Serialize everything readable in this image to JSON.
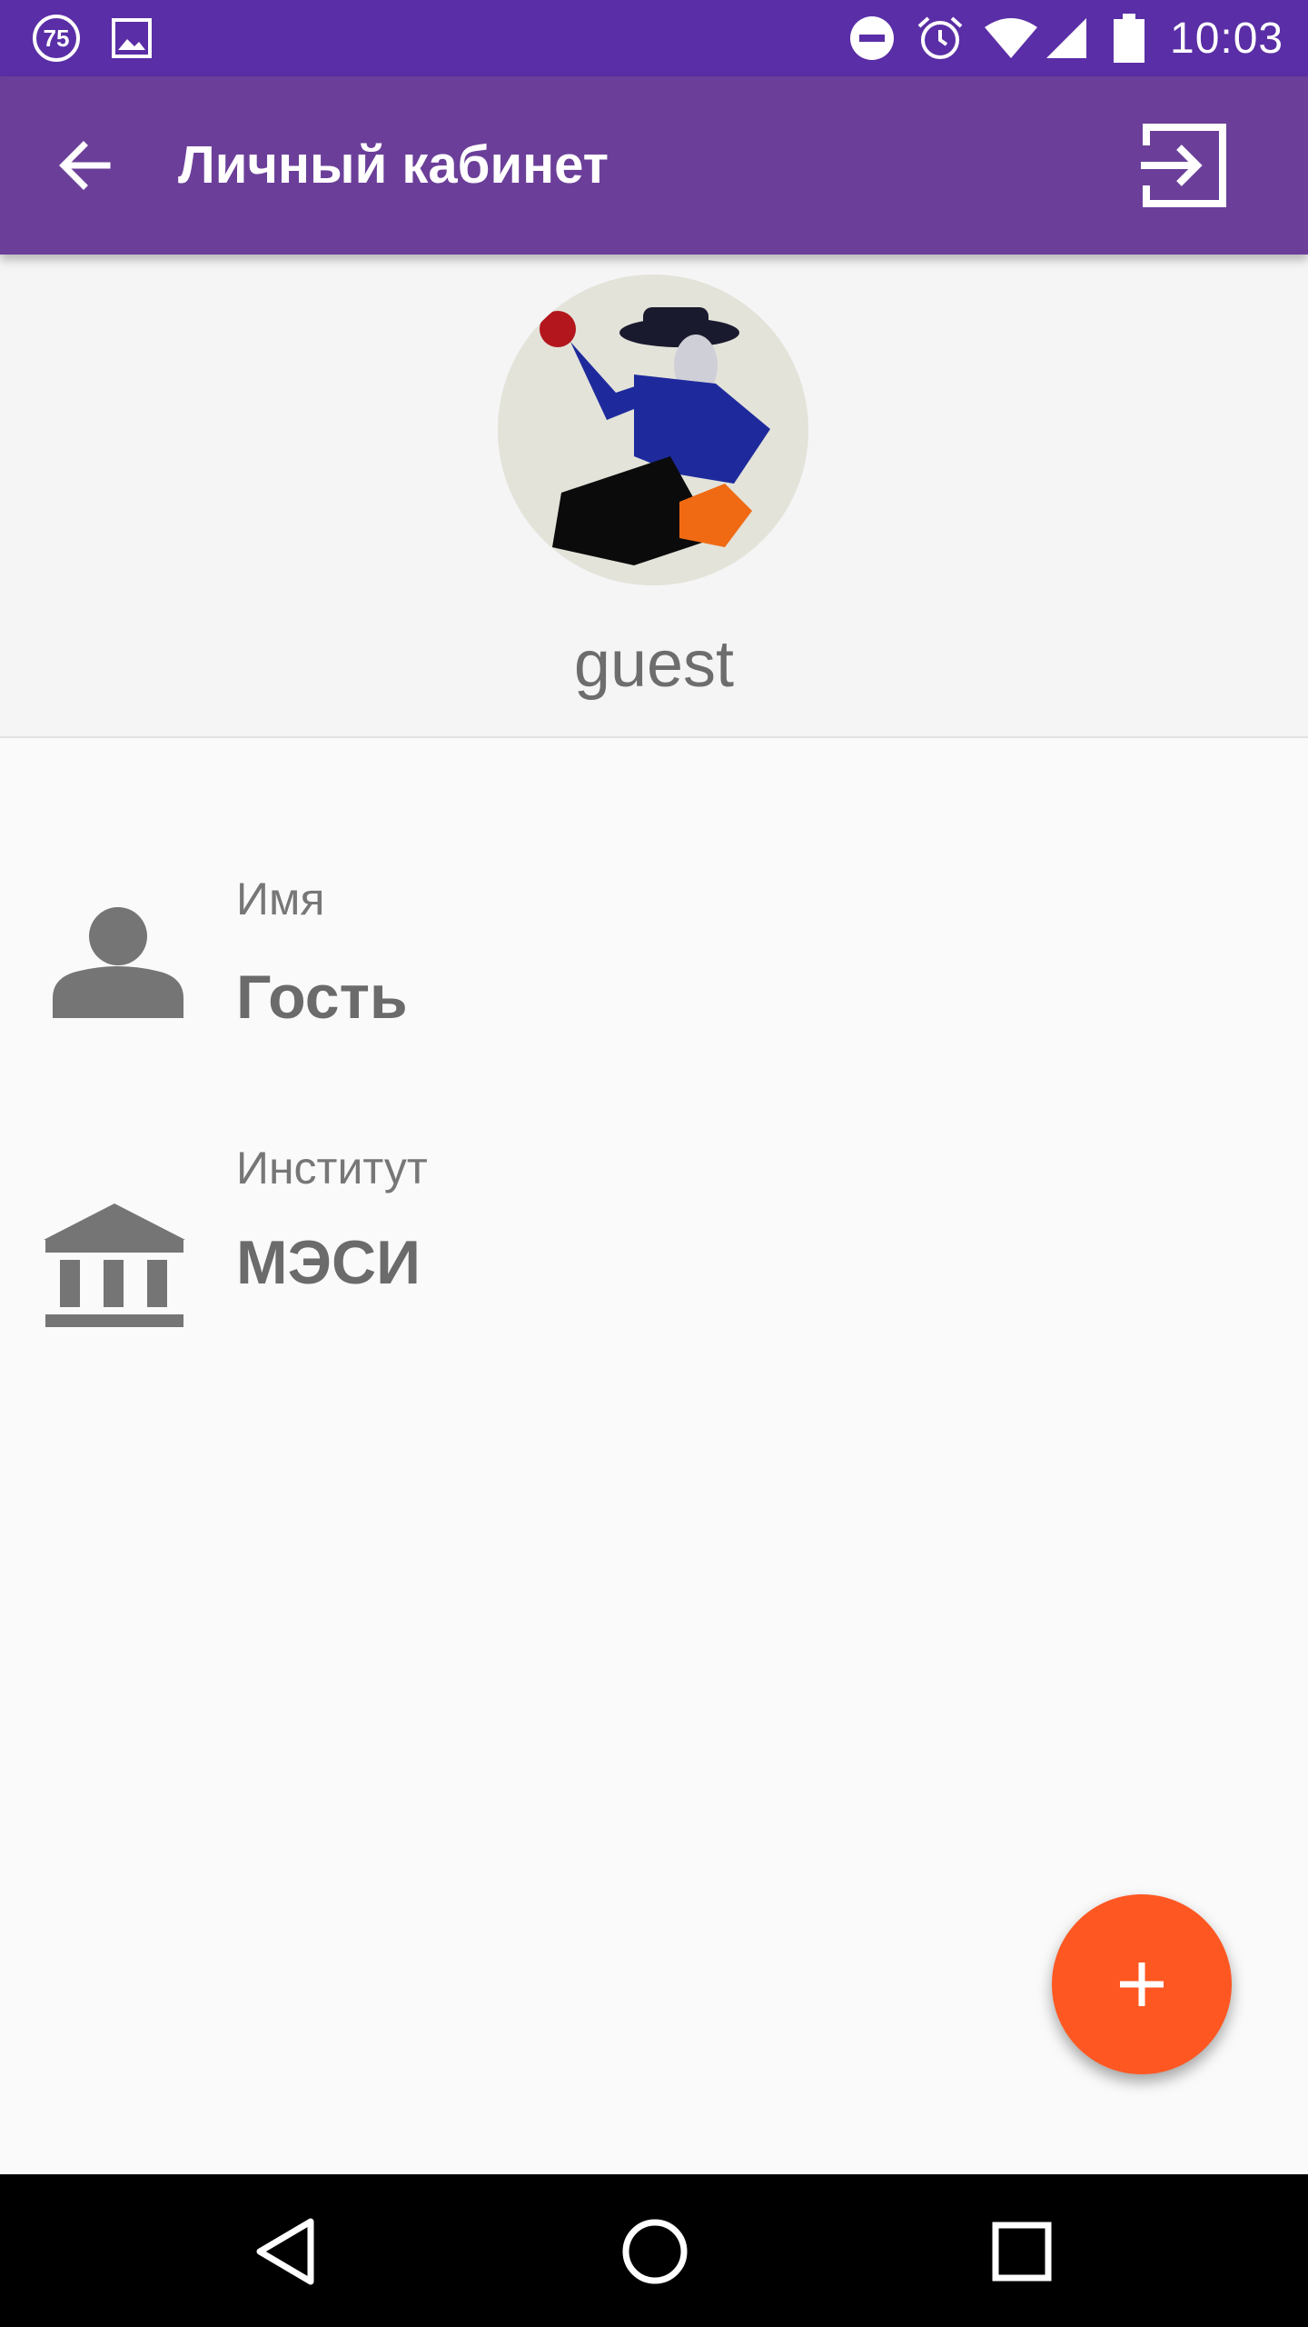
{
  "status_bar": {
    "notification_badge": "75",
    "time": "10:03",
    "icons": [
      "gallery-icon",
      "do-not-disturb-icon",
      "alarm-icon",
      "wifi-icon",
      "signal-icon",
      "battery-icon"
    ]
  },
  "toolbar": {
    "title": "Личный кабинет",
    "back_icon": "arrow-back-icon",
    "logout_icon": "exit-to-app-icon"
  },
  "profile": {
    "username": "guest"
  },
  "fields": [
    {
      "icon": "person-icon",
      "label": "Имя",
      "value": "Гость"
    },
    {
      "icon": "institution-icon",
      "label": "Институт",
      "value": "МЭСИ"
    }
  ],
  "fab": {
    "icon": "plus-icon"
  },
  "nav_bar": {
    "icons": [
      "back-triangle-icon",
      "home-circle-icon",
      "recents-square-icon"
    ]
  },
  "colors": {
    "status_bar": "#5a2ea6",
    "toolbar": "#6b3f99",
    "fab": "#ff5722",
    "background": "#fafafa",
    "icon_gray": "#757575"
  }
}
